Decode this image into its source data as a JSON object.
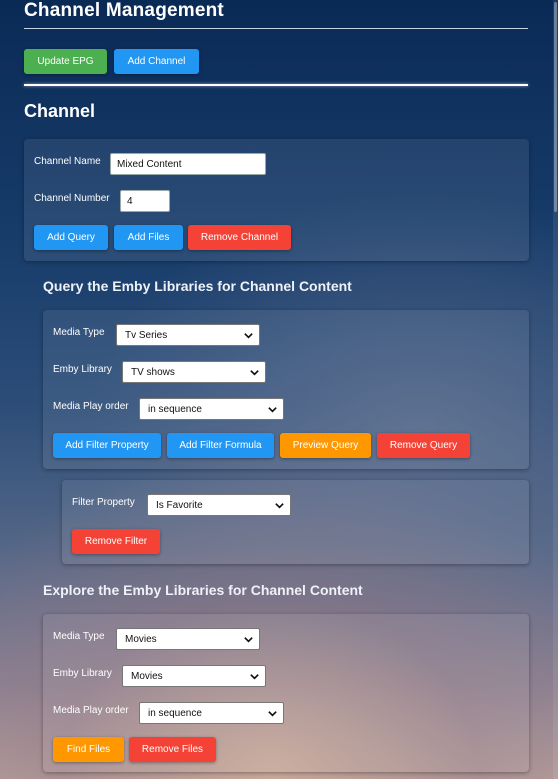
{
  "header": {
    "title": "Channel Management",
    "update_epg_label": "Update EPG",
    "add_channel_label": "Add Channel"
  },
  "channel": {
    "heading": "Channel",
    "name_label": "Channel Name",
    "name_value": "Mixed Content",
    "number_label": "Channel Number",
    "number_value": "4",
    "add_query_label": "Add Query",
    "add_files_label": "Add Files",
    "remove_channel_label": "Remove Channel"
  },
  "query": {
    "heading": "Query the Emby Libraries for Channel Content",
    "media_type_label": "Media Type",
    "media_type_value": "Tv Series",
    "library_label": "Emby Library",
    "library_value": "TV shows",
    "play_order_label": "Media Play order",
    "play_order_value": "in sequence",
    "add_filter_property_label": "Add Filter Property",
    "add_filter_formula_label": "Add Filter Formula",
    "preview_query_label": "Preview Query",
    "remove_query_label": "Remove Query"
  },
  "filter": {
    "property_label": "Filter Property",
    "property_value": "Is Favorite",
    "remove_filter_label": "Remove Filter"
  },
  "explore": {
    "heading": "Explore the Emby Libraries for Channel Content",
    "media_type_label": "Media Type",
    "media_type_value": "Movies",
    "library_label": "Emby Library",
    "library_value": "Movies",
    "play_order_label": "Media Play order",
    "play_order_value": "in sequence",
    "find_files_label": "Find Files",
    "remove_files_label": "Remove Files"
  },
  "colors": {
    "green": "#4caf50",
    "blue": "#2196f3",
    "red": "#f44336",
    "orange": "#ff9800"
  }
}
